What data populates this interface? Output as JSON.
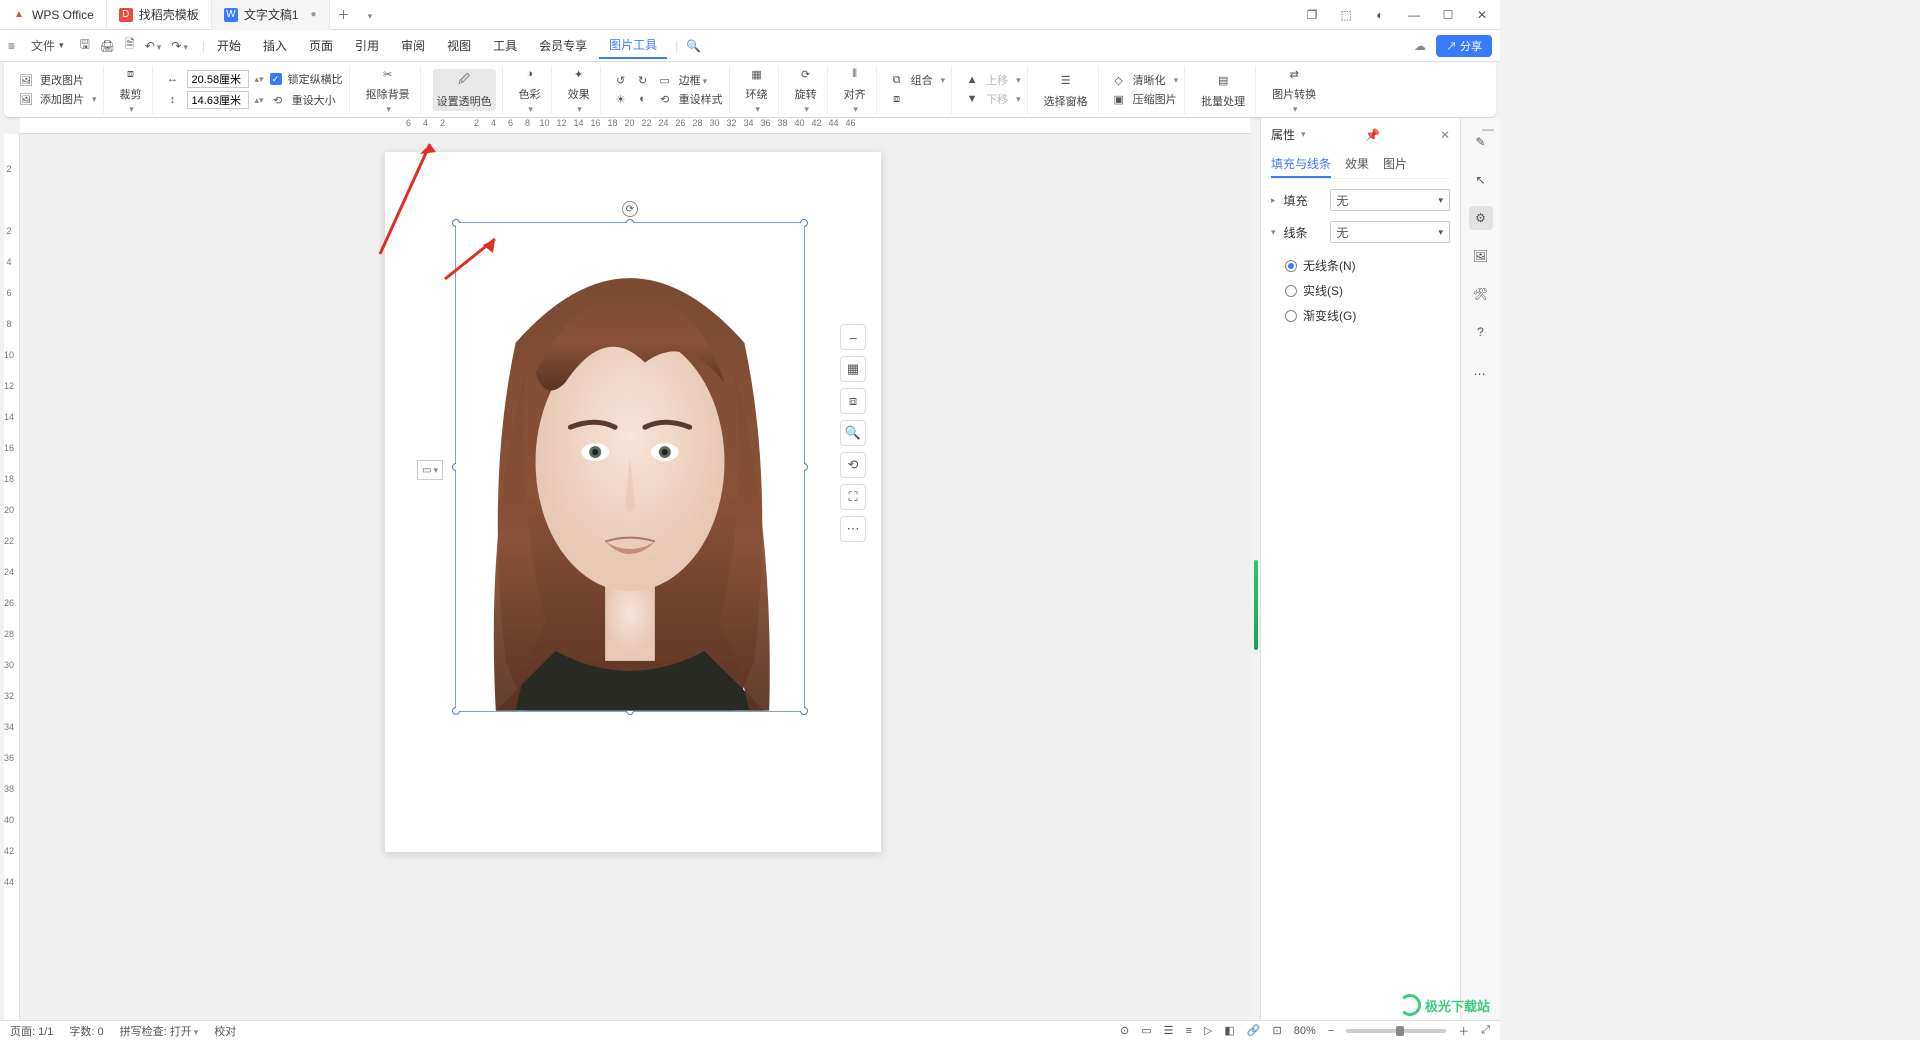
{
  "tabs": [
    {
      "icon": "W",
      "iconColor": "#d84a3a",
      "label": "WPS Office"
    },
    {
      "icon": "D",
      "iconColor": "#e74c3c",
      "label": "找稻壳模板"
    },
    {
      "icon": "W",
      "iconColor": "#3a7bfd",
      "label": "文字文稿1",
      "dirty": "●"
    }
  ],
  "file_menu": "文件",
  "menu": [
    "开始",
    "插入",
    "页面",
    "引用",
    "审阅",
    "视图",
    "工具",
    "会员专享",
    "图片工具"
  ],
  "menu_active": 8,
  "share": "分享",
  "ribbon": {
    "change_img": "更改图片",
    "add_img": "添加图片",
    "crop": "裁剪",
    "width": "20.58厘米",
    "height": "14.63厘米",
    "lock_ratio": "锁定纵横比",
    "reset_size": "重设大小",
    "remove_bg": "抠除背景",
    "set_trans": "设置透明色",
    "color": "色彩",
    "effect": "效果",
    "border": "边框",
    "reset_style": "重设样式",
    "wrap": "环绕",
    "rotate": "旋转",
    "align": "对齐",
    "group": "组合",
    "up": "上移",
    "down": "下移",
    "sel_pane": "选择窗格",
    "sharpen": "清晰化",
    "compress": "压缩图片",
    "batch": "批量处理",
    "convert": "图片转换"
  },
  "hruler": [
    "6",
    "4",
    "2",
    "",
    "2",
    "4",
    "6",
    "8",
    "10",
    "12",
    "14",
    "16",
    "18",
    "20",
    "22",
    "24",
    "26",
    "28",
    "30",
    "32",
    "34",
    "36",
    "38",
    "40",
    "42",
    "44",
    "46"
  ],
  "vruler": [
    "2",
    "",
    "2",
    "4",
    "6",
    "8",
    "10",
    "12",
    "14",
    "16",
    "18",
    "20",
    "22",
    "24",
    "26",
    "28",
    "30",
    "32",
    "34",
    "36",
    "38",
    "40",
    "42",
    "44"
  ],
  "props": {
    "title": "属性",
    "tabs": [
      "填充与线条",
      "效果",
      "图片"
    ],
    "fill": "填充",
    "fill_val": "无",
    "line": "线条",
    "line_val": "无",
    "line_opts": [
      "无线条(N)",
      "实线(S)",
      "渐变线(G)"
    ],
    "line_sel": 0
  },
  "status": {
    "page": "页面: 1/1",
    "words": "字数: 0",
    "spell": "拼写检查: 打开",
    "proof": "校对",
    "zoom": "80%"
  },
  "watermark": "极光下载站"
}
